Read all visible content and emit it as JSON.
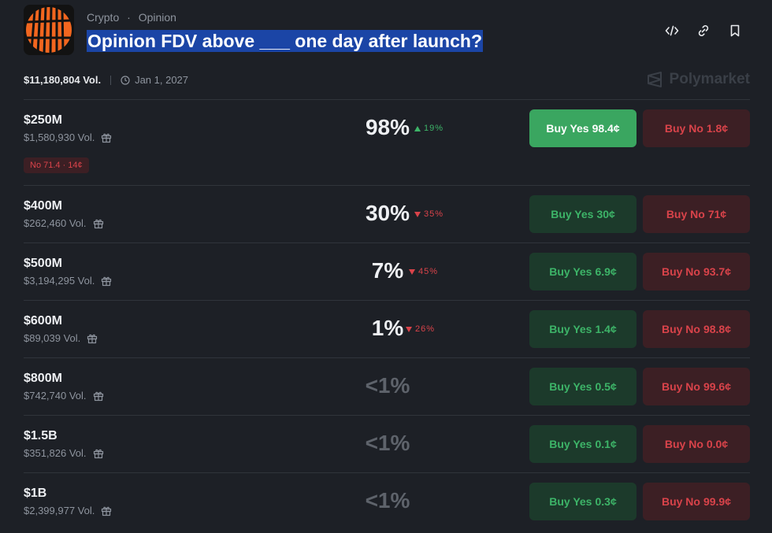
{
  "header": {
    "breadcrumb": [
      "Crypto",
      "Opinion"
    ],
    "breadcrumb_sep": "·",
    "title": "Opinion FDV above ___ one day after launch?",
    "actions": [
      {
        "icon": "code-icon"
      },
      {
        "icon": "link-icon"
      },
      {
        "icon": "bookmark-icon"
      }
    ]
  },
  "meta": {
    "volume": "$11,180,804 Vol.",
    "date": "Jan 1, 2027"
  },
  "brand": {
    "name": "Polymarket"
  },
  "colors": {
    "yes": "#3db468",
    "no": "#d9434a",
    "yes_active_bg": "#3aa660"
  },
  "markets": [
    {
      "label": "$250M",
      "volume": "$1,580,930 Vol.",
      "percent": "98%",
      "change": "19%",
      "direction": "up",
      "yes_label": "Buy Yes",
      "yes_price": "98.4¢",
      "no_label": "Buy No",
      "no_price": "1.8¢",
      "tag": "No 71.4 · 14¢"
    },
    {
      "label": "$400M",
      "volume": "$262,460 Vol.",
      "percent": "30%",
      "change": "35%",
      "direction": "down",
      "yes_label": "Buy Yes",
      "yes_price": "30¢",
      "no_label": "Buy No",
      "no_price": "71¢"
    },
    {
      "label": "$500M",
      "volume": "$3,194,295 Vol.",
      "percent": "7%",
      "change": "45%",
      "direction": "down",
      "yes_label": "Buy Yes",
      "yes_price": "6.9¢",
      "no_label": "Buy No",
      "no_price": "93.7¢"
    },
    {
      "label": "$600M",
      "volume": "$89,039 Vol.",
      "percent": "1%",
      "change": "26%",
      "direction": "down",
      "yes_label": "Buy Yes",
      "yes_price": "1.4¢",
      "no_label": "Buy No",
      "no_price": "98.8¢"
    },
    {
      "label": "$800M",
      "volume": "$742,740 Vol.",
      "percent": "<1%",
      "yes_label": "Buy Yes",
      "yes_price": "0.5¢",
      "no_label": "Buy No",
      "no_price": "99.6¢"
    },
    {
      "label": "$1.5B",
      "volume": "$351,826 Vol.",
      "percent": "<1%",
      "yes_label": "Buy Yes",
      "yes_price": "0.1¢",
      "no_label": "Buy No",
      "no_price": "0.0¢"
    },
    {
      "label": "$1B",
      "volume": "$2,399,977 Vol.",
      "percent": "<1%",
      "yes_label": "Buy Yes",
      "yes_price": "0.3¢",
      "no_label": "Buy No",
      "no_price": "99.9¢"
    }
  ]
}
